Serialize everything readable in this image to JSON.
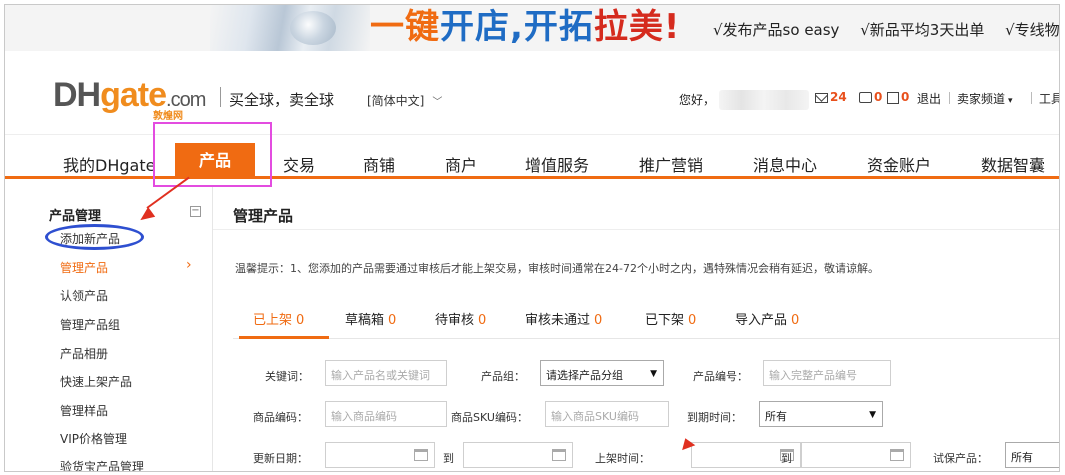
{
  "banner": {
    "slogan_part1": "一键",
    "slogan_part2": "开店,",
    "slogan_part3": "开拓",
    "slogan_part4": "拉美!",
    "features": [
      "√发布产品so easy",
      "√新品平均3天出单",
      "√专线物"
    ]
  },
  "header": {
    "logo_dh": "DH",
    "logo_gate": "gate",
    "logo_com": ".com",
    "logo_cn": "敦煌网",
    "tagline": "买全球，卖全球",
    "language": "[简体中文]",
    "greeting": "您好，",
    "mail_count": "24",
    "chat_count": "0",
    "notice_count": "0",
    "logout": "退出",
    "seller_channel": "卖家频道",
    "tools": "工具"
  },
  "nav": {
    "items": [
      "我的DHgate",
      "产品",
      "交易",
      "商铺",
      "商户",
      "增值服务",
      "推广营销",
      "消息中心",
      "资金账户",
      "数据智囊"
    ],
    "active_index": 1
  },
  "sidebar": {
    "title": "产品管理",
    "items": [
      "添加新产品",
      "管理产品",
      "认领产品",
      "管理产品组",
      "产品相册",
      "快速上架产品",
      "管理样品",
      "VIP价格管理",
      "验货宝产品管理"
    ],
    "active_index": 1
  },
  "main": {
    "title": "管理产品",
    "tip": "温馨提示：1、您添加的产品需要通过审核后才能上架交易，审核时间通常在24-72个小时之内，遇特殊情况会稍有延迟，敬请谅解。",
    "tabs": [
      {
        "label": "已上架",
        "count": "0"
      },
      {
        "label": "草稿箱",
        "count": "0"
      },
      {
        "label": "待审核",
        "count": "0"
      },
      {
        "label": "审核未通过",
        "count": "0"
      },
      {
        "label": "已下架",
        "count": "0"
      },
      {
        "label": "导入产品",
        "count": "0"
      }
    ],
    "filters": {
      "keyword_label": "关键词：",
      "keyword_placeholder": "输入产品名或关键词",
      "group_label": "产品组：",
      "group_value": "请选择产品分组",
      "product_no_label": "产品编号：",
      "product_no_placeholder": "输入完整产品编号",
      "goods_code_label": "商品编码：",
      "goods_code_placeholder": "输入商品编码",
      "sku_label": "商品SKU编码：",
      "sku_placeholder": "输入商品SKU编码",
      "expire_label": "到期时间：",
      "expire_value": "所有",
      "update_label": "更新日期：",
      "to_label": "到",
      "listed_label": "上架时间：",
      "guarantee_label": "试保产品：",
      "guarantee_value": "所有"
    }
  }
}
